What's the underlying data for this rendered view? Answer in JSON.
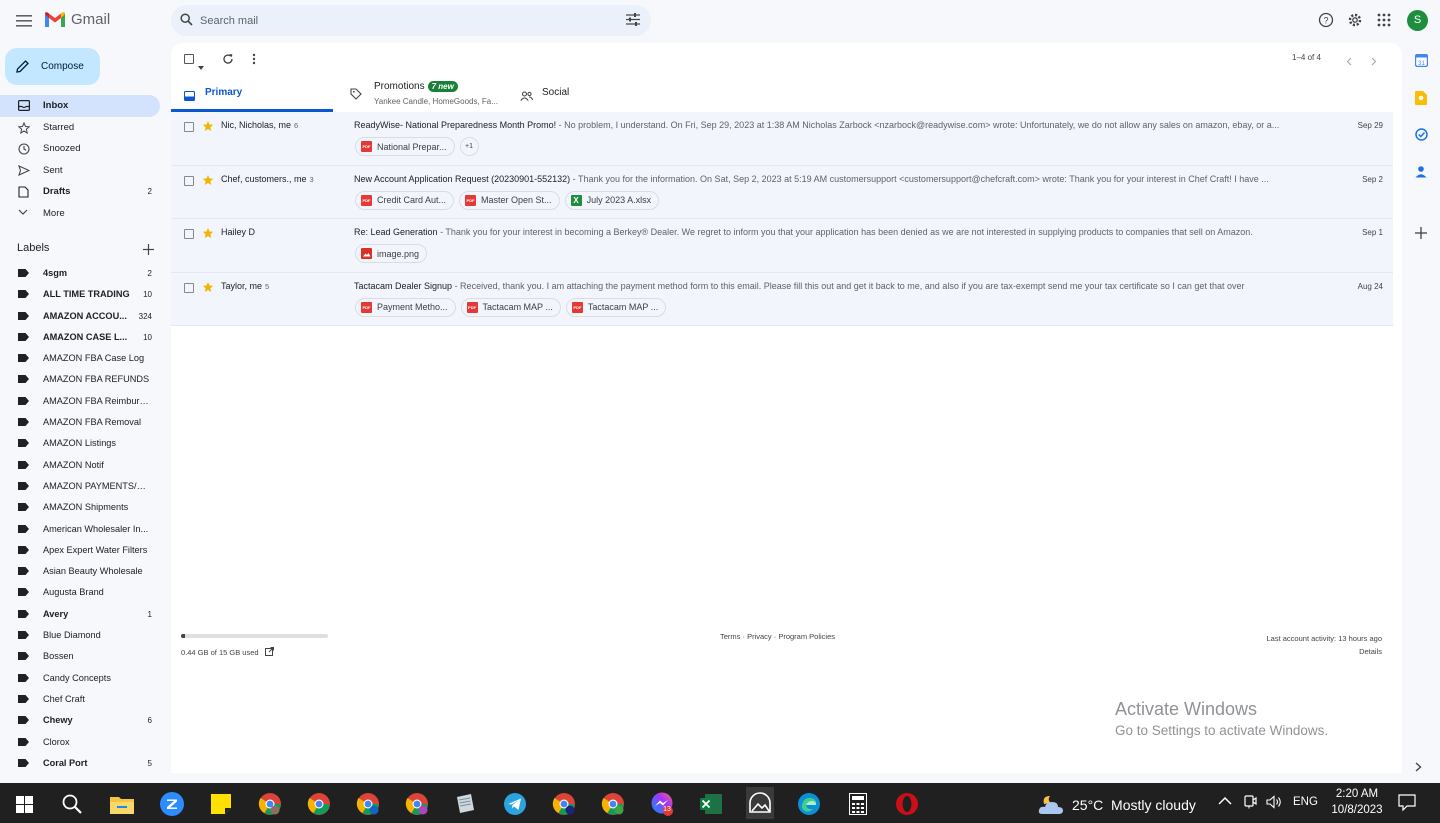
{
  "app": {
    "name": "Gmail"
  },
  "search": {
    "placeholder": "Search mail"
  },
  "user": {
    "initial": "S",
    "avatar_color": "#1e8e3e"
  },
  "compose_label": "Compose",
  "nav": [
    {
      "label": "Inbox",
      "icon": "inbox-icon",
      "count": "",
      "active": true
    },
    {
      "label": "Starred",
      "icon": "star-outline-icon",
      "count": ""
    },
    {
      "label": "Snoozed",
      "icon": "clock-icon",
      "count": ""
    },
    {
      "label": "Sent",
      "icon": "send-icon",
      "count": ""
    },
    {
      "label": "Drafts",
      "icon": "draft-icon",
      "count": "2",
      "bold": true
    },
    {
      "label": "More",
      "icon": "chevron-down-icon",
      "count": ""
    }
  ],
  "labels_title": "Labels",
  "labels": [
    {
      "name": "4sgm",
      "count": "2",
      "bold": true
    },
    {
      "name": "ALL TIME TRADING",
      "count": "10",
      "bold": true
    },
    {
      "name": "AMAZON ACCOU...",
      "count": "324",
      "bold": true
    },
    {
      "name": "AMAZON CASE L...",
      "count": "10",
      "bold": true
    },
    {
      "name": "AMAZON FBA Case Log",
      "count": ""
    },
    {
      "name": "AMAZON FBA REFUNDS",
      "count": ""
    },
    {
      "name": "AMAZON FBA Reimburs...",
      "count": ""
    },
    {
      "name": "AMAZON FBA Removal",
      "count": ""
    },
    {
      "name": "AMAZON Listings",
      "count": ""
    },
    {
      "name": "AMAZON Notif",
      "count": ""
    },
    {
      "name": "AMAZON PAYMENTS/SE...",
      "count": ""
    },
    {
      "name": "AMAZON Shipments",
      "count": ""
    },
    {
      "name": "American Wholesaler In...",
      "count": ""
    },
    {
      "name": "Apex Expert Water Filters",
      "count": ""
    },
    {
      "name": "Asian Beauty Wholesale",
      "count": ""
    },
    {
      "name": "Augusta Brand",
      "count": ""
    },
    {
      "name": "Avery",
      "count": "1",
      "bold": true
    },
    {
      "name": "Blue Diamond",
      "count": ""
    },
    {
      "name": "Bossen",
      "count": ""
    },
    {
      "name": "Candy Concepts",
      "count": ""
    },
    {
      "name": "Chef Craft",
      "count": ""
    },
    {
      "name": "Chewy",
      "count": "6",
      "bold": true
    },
    {
      "name": "Clorox",
      "count": ""
    },
    {
      "name": "Coral Port",
      "count": "5",
      "bold": true
    }
  ],
  "pager": "1–4 of 4",
  "tabs": {
    "primary": "Primary",
    "promotions": "Promotions",
    "promotions_badge": "7 new",
    "promotions_sub": "Yankee Candle, HomeGoods, Fa...",
    "social": "Social"
  },
  "emails": [
    {
      "sender": "Nic, Nicholas, me",
      "count": "6",
      "subject": "ReadyWise- National Preparedness Month Promo!",
      "snippet": " - No problem, I understand. On Fri, Sep 29, 2023 at 1:38 AM Nicholas Zarbock <nzarbock@readywise.com> wrote: Unfortunately, we do not allow any sales on amazon, ebay, or a...",
      "date": "Sep 29",
      "attachments": [
        {
          "name": "National Prepar...",
          "type": "pdf"
        }
      ],
      "more": "+1"
    },
    {
      "sender": "Chef, customers., me",
      "count": "3",
      "subject": "New Account Application Request (20230901-552132)",
      "snippet": " - Thank you for the information. On Sat, Sep 2, 2023 at 5:19 AM customersupport <customersupport@chefcraft.com> wrote: Thank you for your interest in Chef Craft! I have ...",
      "date": "Sep 2",
      "attachments": [
        {
          "name": "Credit Card Aut...",
          "type": "pdf"
        },
        {
          "name": "Master Open St...",
          "type": "pdf"
        },
        {
          "name": "July 2023 A.xlsx",
          "type": "xls"
        }
      ],
      "more": ""
    },
    {
      "sender": "Hailey D",
      "count": "",
      "subject": "Re: Lead Generation",
      "snippet": " - Thank you for your interest in becoming a Berkey® Dealer. We regret to inform you that your application has been denied as we are not interested in supplying products to companies that sell on Amazon.",
      "date": "Sep 1",
      "attachments": [
        {
          "name": "image.png",
          "type": "img"
        }
      ],
      "more": ""
    },
    {
      "sender": "Taylor, me",
      "count": "5",
      "subject": "Tactacam Dealer Signup",
      "snippet": " - Received, thank you. I am attaching the payment method form to this email. Please fill this out and get it back to me, and also if you are tax-exempt send me your tax certificate so I can get that over",
      "date": "Aug 24",
      "attachments": [
        {
          "name": "Payment Metho...",
          "type": "pdf"
        },
        {
          "name": "Tactacam MAP ...",
          "type": "pdf"
        },
        {
          "name": "Tactacam MAP ...",
          "type": "pdf"
        }
      ],
      "more": ""
    }
  ],
  "storage": {
    "text": "0.44 GB of 15 GB used",
    "fraction": 0.029
  },
  "footer_links": "Terms · Privacy · Program Policies",
  "last_activity": "Last account activity: 13 hours ago",
  "details": "Details",
  "activate": {
    "line1": "Activate Windows",
    "line2": "Go to Settings to activate Windows."
  },
  "taskbar": {
    "weather": "25°C  Mostly cloudy",
    "lang": "ENG",
    "time": "2:20 AM",
    "date": "10/8/2023",
    "badge": "13"
  },
  "pdf_label": "PDF"
}
